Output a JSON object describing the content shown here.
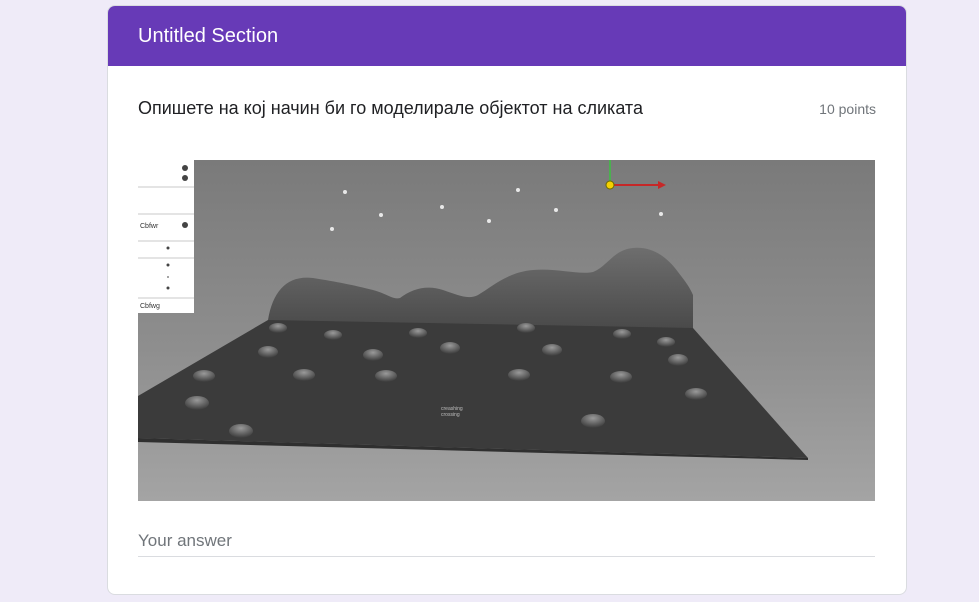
{
  "section": {
    "title": "Untitled Section",
    "accent_color": "#673ab7"
  },
  "question": {
    "title": "Опишете на кој начин би го моделирале објектот на сликата",
    "points": "10 points",
    "image_subject": "3D modeling viewport: grey terrain plane with bumps and a wavy wall",
    "image_panel_labels": [
      "Cbfwr",
      "Cbfwg"
    ],
    "image_center_text": "creashing\ncrossing"
  },
  "answer": {
    "placeholder": "Your answer",
    "value": ""
  }
}
